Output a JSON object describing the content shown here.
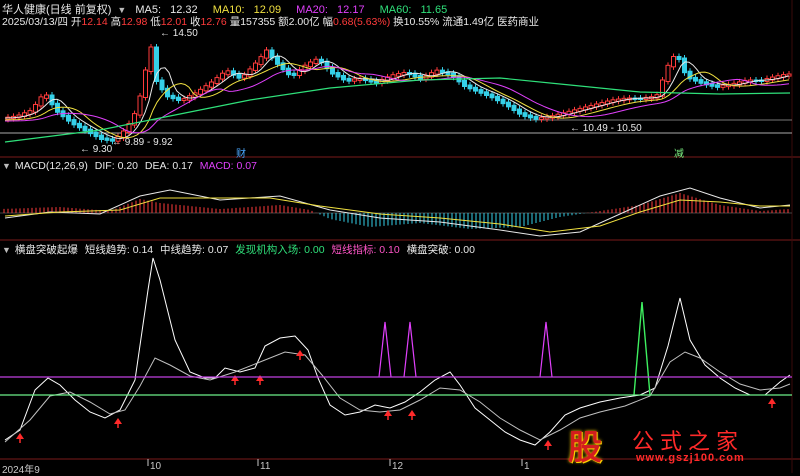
{
  "stock": {
    "name": "华人健康(日线 前复权)",
    "ma": [
      {
        "label": "MA5:",
        "value": "12.32",
        "color": "#e8e8e8"
      },
      {
        "label": "MA10:",
        "value": "12.09",
        "color": "#f0e040"
      },
      {
        "label": "MA20:",
        "value": "12.17",
        "color": "#e040fb"
      },
      {
        "label": "MA60:",
        "value": "11.65",
        "color": "#2fe07a"
      }
    ]
  },
  "info": {
    "date": "2025/03/13/四",
    "open_label": "开",
    "open": "12.14",
    "high_label": "高",
    "high": "12.98",
    "low_label": "低",
    "low": "12.01",
    "close_label": "收",
    "close": "12.76",
    "vol_label": "量",
    "vol": "157355",
    "amt_label": "额",
    "amt": "2.00亿",
    "chg_label": "幅",
    "chg": "0.68(5.63%)",
    "turnover_label": "换",
    "turnover": "10.55%",
    "float_label": "流通",
    "float": "1.49亿",
    "industry": "医药商业"
  },
  "price_annotations": {
    "high": "14.50",
    "low_range": "10.49 - 10.50",
    "mid_range": "9.89 - 9.92",
    "low": "9.30",
    "marker_cai": "财",
    "marker_jian": "减"
  },
  "macd": {
    "title": "MACD(12,26,9)",
    "dif_label": "DIF:",
    "dif": "0.20",
    "dea_label": "DEA:",
    "dea": "0.17",
    "macd_label": "MACD:",
    "macd": "0.07"
  },
  "indicator": {
    "title": "横盘突破起爆",
    "short_label": "短线趋势:",
    "short": "0.14",
    "mid_label": "中线趋势:",
    "mid": "0.07",
    "inst_label": "发现机构入场:",
    "inst": "0.00",
    "short_idx_label": "短线指标:",
    "short_idx": "0.10",
    "break_label": "横盘突破:",
    "break": "0.00"
  },
  "x_axis": [
    "2024年9",
    "10",
    "11",
    "12",
    "1"
  ],
  "watermark": {
    "big": "股",
    "cn": "公式之家",
    "url": "www.gszj100.com"
  },
  "colors": {
    "up": "#ff3b3b",
    "down": "#35d0e8",
    "ma5": "#e8e8e8",
    "ma10": "#f0e040",
    "ma20": "#e040fb",
    "ma60": "#2fe07a",
    "grid": "#5a1010"
  }
}
